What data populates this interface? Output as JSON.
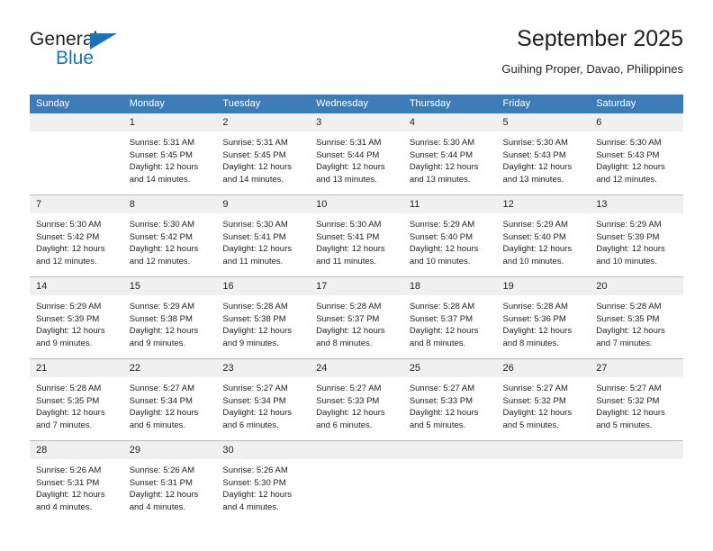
{
  "brand": {
    "name_part1": "General",
    "name_part2": "Blue",
    "accent_color": "#1a72b8"
  },
  "header": {
    "title": "September 2025",
    "subtitle": "Guihing Proper, Davao, Philippines"
  },
  "calendar": {
    "header_color": "#3b7cb9",
    "daynum_band_color": "#f0f0f0",
    "weekdays": [
      "Sunday",
      "Monday",
      "Tuesday",
      "Wednesday",
      "Thursday",
      "Friday",
      "Saturday"
    ],
    "weeks": [
      [
        {
          "day": "",
          "blank": true,
          "sunrise": "",
          "sunset": "",
          "daylight1": "",
          "daylight2": ""
        },
        {
          "day": "1",
          "blank": false,
          "sunrise": "Sunrise: 5:31 AM",
          "sunset": "Sunset: 5:45 PM",
          "daylight1": "Daylight: 12 hours",
          "daylight2": "and 14 minutes."
        },
        {
          "day": "2",
          "blank": false,
          "sunrise": "Sunrise: 5:31 AM",
          "sunset": "Sunset: 5:45 PM",
          "daylight1": "Daylight: 12 hours",
          "daylight2": "and 14 minutes."
        },
        {
          "day": "3",
          "blank": false,
          "sunrise": "Sunrise: 5:31 AM",
          "sunset": "Sunset: 5:44 PM",
          "daylight1": "Daylight: 12 hours",
          "daylight2": "and 13 minutes."
        },
        {
          "day": "4",
          "blank": false,
          "sunrise": "Sunrise: 5:30 AM",
          "sunset": "Sunset: 5:44 PM",
          "daylight1": "Daylight: 12 hours",
          "daylight2": "and 13 minutes."
        },
        {
          "day": "5",
          "blank": false,
          "sunrise": "Sunrise: 5:30 AM",
          "sunset": "Sunset: 5:43 PM",
          "daylight1": "Daylight: 12 hours",
          "daylight2": "and 13 minutes."
        },
        {
          "day": "6",
          "blank": false,
          "sunrise": "Sunrise: 5:30 AM",
          "sunset": "Sunset: 5:43 PM",
          "daylight1": "Daylight: 12 hours",
          "daylight2": "and 12 minutes."
        }
      ],
      [
        {
          "day": "7",
          "blank": false,
          "sunrise": "Sunrise: 5:30 AM",
          "sunset": "Sunset: 5:42 PM",
          "daylight1": "Daylight: 12 hours",
          "daylight2": "and 12 minutes."
        },
        {
          "day": "8",
          "blank": false,
          "sunrise": "Sunrise: 5:30 AM",
          "sunset": "Sunset: 5:42 PM",
          "daylight1": "Daylight: 12 hours",
          "daylight2": "and 12 minutes."
        },
        {
          "day": "9",
          "blank": false,
          "sunrise": "Sunrise: 5:30 AM",
          "sunset": "Sunset: 5:41 PM",
          "daylight1": "Daylight: 12 hours",
          "daylight2": "and 11 minutes."
        },
        {
          "day": "10",
          "blank": false,
          "sunrise": "Sunrise: 5:30 AM",
          "sunset": "Sunset: 5:41 PM",
          "daylight1": "Daylight: 12 hours",
          "daylight2": "and 11 minutes."
        },
        {
          "day": "11",
          "blank": false,
          "sunrise": "Sunrise: 5:29 AM",
          "sunset": "Sunset: 5:40 PM",
          "daylight1": "Daylight: 12 hours",
          "daylight2": "and 10 minutes."
        },
        {
          "day": "12",
          "blank": false,
          "sunrise": "Sunrise: 5:29 AM",
          "sunset": "Sunset: 5:40 PM",
          "daylight1": "Daylight: 12 hours",
          "daylight2": "and 10 minutes."
        },
        {
          "day": "13",
          "blank": false,
          "sunrise": "Sunrise: 5:29 AM",
          "sunset": "Sunset: 5:39 PM",
          "daylight1": "Daylight: 12 hours",
          "daylight2": "and 10 minutes."
        }
      ],
      [
        {
          "day": "14",
          "blank": false,
          "sunrise": "Sunrise: 5:29 AM",
          "sunset": "Sunset: 5:39 PM",
          "daylight1": "Daylight: 12 hours",
          "daylight2": "and 9 minutes."
        },
        {
          "day": "15",
          "blank": false,
          "sunrise": "Sunrise: 5:29 AM",
          "sunset": "Sunset: 5:38 PM",
          "daylight1": "Daylight: 12 hours",
          "daylight2": "and 9 minutes."
        },
        {
          "day": "16",
          "blank": false,
          "sunrise": "Sunrise: 5:28 AM",
          "sunset": "Sunset: 5:38 PM",
          "daylight1": "Daylight: 12 hours",
          "daylight2": "and 9 minutes."
        },
        {
          "day": "17",
          "blank": false,
          "sunrise": "Sunrise: 5:28 AM",
          "sunset": "Sunset: 5:37 PM",
          "daylight1": "Daylight: 12 hours",
          "daylight2": "and 8 minutes."
        },
        {
          "day": "18",
          "blank": false,
          "sunrise": "Sunrise: 5:28 AM",
          "sunset": "Sunset: 5:37 PM",
          "daylight1": "Daylight: 12 hours",
          "daylight2": "and 8 minutes."
        },
        {
          "day": "19",
          "blank": false,
          "sunrise": "Sunrise: 5:28 AM",
          "sunset": "Sunset: 5:36 PM",
          "daylight1": "Daylight: 12 hours",
          "daylight2": "and 8 minutes."
        },
        {
          "day": "20",
          "blank": false,
          "sunrise": "Sunrise: 5:28 AM",
          "sunset": "Sunset: 5:35 PM",
          "daylight1": "Daylight: 12 hours",
          "daylight2": "and 7 minutes."
        }
      ],
      [
        {
          "day": "21",
          "blank": false,
          "sunrise": "Sunrise: 5:28 AM",
          "sunset": "Sunset: 5:35 PM",
          "daylight1": "Daylight: 12 hours",
          "daylight2": "and 7 minutes."
        },
        {
          "day": "22",
          "blank": false,
          "sunrise": "Sunrise: 5:27 AM",
          "sunset": "Sunset: 5:34 PM",
          "daylight1": "Daylight: 12 hours",
          "daylight2": "and 6 minutes."
        },
        {
          "day": "23",
          "blank": false,
          "sunrise": "Sunrise: 5:27 AM",
          "sunset": "Sunset: 5:34 PM",
          "daylight1": "Daylight: 12 hours",
          "daylight2": "and 6 minutes."
        },
        {
          "day": "24",
          "blank": false,
          "sunrise": "Sunrise: 5:27 AM",
          "sunset": "Sunset: 5:33 PM",
          "daylight1": "Daylight: 12 hours",
          "daylight2": "and 6 minutes."
        },
        {
          "day": "25",
          "blank": false,
          "sunrise": "Sunrise: 5:27 AM",
          "sunset": "Sunset: 5:33 PM",
          "daylight1": "Daylight: 12 hours",
          "daylight2": "and 5 minutes."
        },
        {
          "day": "26",
          "blank": false,
          "sunrise": "Sunrise: 5:27 AM",
          "sunset": "Sunset: 5:32 PM",
          "daylight1": "Daylight: 12 hours",
          "daylight2": "and 5 minutes."
        },
        {
          "day": "27",
          "blank": false,
          "sunrise": "Sunrise: 5:27 AM",
          "sunset": "Sunset: 5:32 PM",
          "daylight1": "Daylight: 12 hours",
          "daylight2": "and 5 minutes."
        }
      ],
      [
        {
          "day": "28",
          "blank": false,
          "sunrise": "Sunrise: 5:26 AM",
          "sunset": "Sunset: 5:31 PM",
          "daylight1": "Daylight: 12 hours",
          "daylight2": "and 4 minutes."
        },
        {
          "day": "29",
          "blank": false,
          "sunrise": "Sunrise: 5:26 AM",
          "sunset": "Sunset: 5:31 PM",
          "daylight1": "Daylight: 12 hours",
          "daylight2": "and 4 minutes."
        },
        {
          "day": "30",
          "blank": false,
          "sunrise": "Sunrise: 5:26 AM",
          "sunset": "Sunset: 5:30 PM",
          "daylight1": "Daylight: 12 hours",
          "daylight2": "and 4 minutes."
        },
        {
          "day": "",
          "blank": true,
          "sunrise": "",
          "sunset": "",
          "daylight1": "",
          "daylight2": ""
        },
        {
          "day": "",
          "blank": true,
          "sunrise": "",
          "sunset": "",
          "daylight1": "",
          "daylight2": ""
        },
        {
          "day": "",
          "blank": true,
          "sunrise": "",
          "sunset": "",
          "daylight1": "",
          "daylight2": ""
        },
        {
          "day": "",
          "blank": true,
          "sunrise": "",
          "sunset": "",
          "daylight1": "",
          "daylight2": ""
        }
      ]
    ]
  }
}
